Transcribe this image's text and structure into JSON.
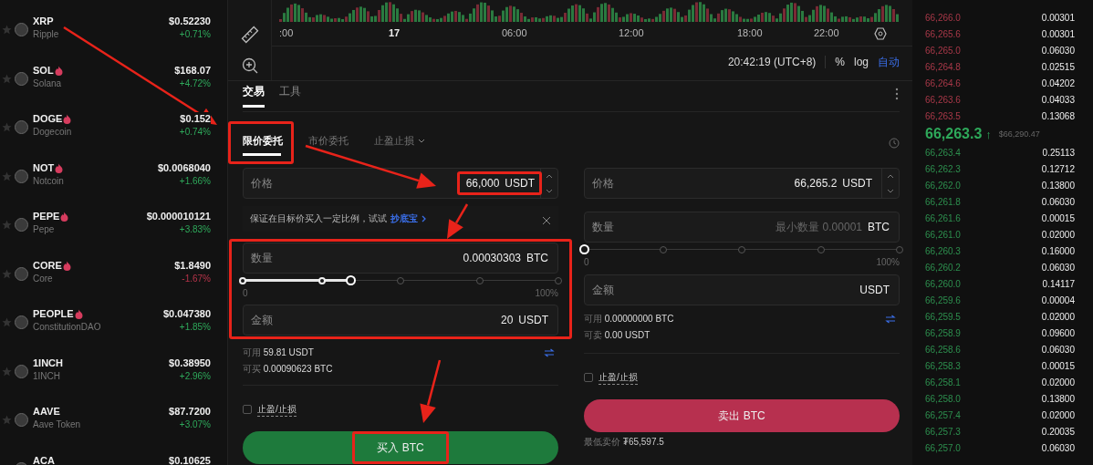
{
  "coins": [
    {
      "symbol": "XRP",
      "name": "Ripple",
      "price": "$0.52230",
      "change": "+0.71%",
      "kind": "gain",
      "hot": false
    },
    {
      "symbol": "SOL",
      "name": "Solana",
      "price": "$168.07",
      "change": "+4.72%",
      "kind": "gain",
      "hot": true
    },
    {
      "symbol": "DOGE",
      "name": "Dogecoin",
      "price": "$0.152",
      "change": "+0.74%",
      "kind": "gain",
      "hot": true
    },
    {
      "symbol": "NOT",
      "name": "Notcoin",
      "price": "$0.0068040",
      "change": "+1.66%",
      "kind": "gain",
      "hot": true
    },
    {
      "symbol": "PEPE",
      "name": "Pepe",
      "price": "$0.000010121",
      "change": "+3.83%",
      "kind": "gain",
      "hot": true
    },
    {
      "symbol": "CORE",
      "name": "Core",
      "price": "$1.8490",
      "change": "-1.67%",
      "kind": "loss",
      "hot": true
    },
    {
      "symbol": "PEOPLE",
      "name": "ConstitutionDAO",
      "price": "$0.047380",
      "change": "+1.85%",
      "kind": "gain",
      "hot": true
    },
    {
      "symbol": "1INCH",
      "name": "1INCH",
      "price": "$0.38950",
      "change": "+2.96%",
      "kind": "gain",
      "hot": false
    },
    {
      "symbol": "AAVE",
      "name": "Aave Token",
      "price": "$87.7200",
      "change": "+3.07%",
      "kind": "gain",
      "hot": false
    },
    {
      "symbol": "ACA",
      "price": "$0.10625",
      "hot": false
    }
  ],
  "chart": {
    "time_labels": [
      ":00",
      "17",
      "06:00",
      "12:00",
      "18:00",
      "22:00"
    ],
    "clock": "20:42:19 (UTC+8)",
    "scale_buttons": [
      {
        "label": "%",
        "selected": false
      },
      {
        "label": "log",
        "selected": false
      },
      {
        "label": "自动",
        "selected": true
      }
    ]
  },
  "trade": {
    "tabs": [
      {
        "label": "交易",
        "selected": true
      },
      {
        "label": "工具",
        "selected": false
      }
    ],
    "order_types": [
      {
        "label": "限价委托",
        "selected": true,
        "highlighted": true,
        "dropdown": false
      },
      {
        "label": "市价委托",
        "selected": false,
        "highlighted": false,
        "dropdown": false
      },
      {
        "label": "止盈止损",
        "selected": false,
        "highlighted": false,
        "dropdown": true
      }
    ],
    "buy": {
      "price": {
        "label": "价格",
        "value": "66,000",
        "unit": "USDT",
        "highlighted": true
      },
      "tip": {
        "text": "保证在目标价买入一定比例，试试",
        "link": "抄底宝"
      },
      "group_highlighted": true,
      "quantity": {
        "label": "数量",
        "value": "0.00030303",
        "unit": "BTC"
      },
      "slider": {
        "level": 0.34,
        "min_label": "0",
        "max_label": "100%"
      },
      "amount": {
        "label": "金额",
        "value": "20",
        "unit": "USDT"
      },
      "balances": [
        {
          "label": "可用",
          "value": "59.81 USDT"
        },
        {
          "label": "可买",
          "value": "0.00090623 BTC"
        }
      ],
      "tp_sl": {
        "label": "止盈/止损",
        "checked": false
      },
      "button": {
        "label": "买入 BTC",
        "highlighted": true
      }
    },
    "sell": {
      "price": {
        "label": "价格",
        "value": "66,265.2",
        "unit": "USDT",
        "highlighted": false
      },
      "quantity": {
        "label": "数量",
        "placeholder": "最小数量 0.00001",
        "unit": "BTC"
      },
      "slider": {
        "level": 0,
        "min_label": "0",
        "max_label": "100%"
      },
      "amount": {
        "label": "金额",
        "unit": "USDT"
      },
      "balances": [
        {
          "label": "可用",
          "value": "0.00000000 BTC"
        },
        {
          "label": "可卖",
          "value": "0.00 USDT"
        }
      ],
      "tp_sl": {
        "label": "止盈/止损",
        "checked": false
      },
      "button": {
        "label": "卖出 BTC",
        "highlighted": false
      },
      "note_label": "最低卖价",
      "note_value": "₮65,597.5"
    }
  },
  "order_book": {
    "asks": [
      {
        "price": "66,266.0",
        "amount": "0.00301"
      },
      {
        "price": "66,265.6",
        "amount": "0.00301"
      },
      {
        "price": "66,265.0",
        "amount": "0.06030"
      },
      {
        "price": "66,264.8",
        "amount": "0.02515"
      },
      {
        "price": "66,264.6",
        "amount": "0.04202"
      },
      {
        "price": "66,263.6",
        "amount": "0.04033"
      },
      {
        "price": "66,263.5",
        "amount": "0.13068"
      }
    ],
    "last_price": "66,263.3",
    "last_arrow": "↑",
    "index_price": "$66,290.47",
    "bids": [
      {
        "price": "66,263.4",
        "amount": "0.25113"
      },
      {
        "price": "66,262.3",
        "amount": "0.12712"
      },
      {
        "price": "66,262.0",
        "amount": "0.13800"
      },
      {
        "price": "66,261.8",
        "amount": "0.06030"
      },
      {
        "price": "66,261.6",
        "amount": "0.00015"
      },
      {
        "price": "66,261.0",
        "amount": "0.02000"
      },
      {
        "price": "66,260.3",
        "amount": "0.16000"
      },
      {
        "price": "66,260.2",
        "amount": "0.06030"
      },
      {
        "price": "66,260.0",
        "amount": "0.14117"
      },
      {
        "price": "66,259.6",
        "amount": "0.00004"
      },
      {
        "price": "66,259.5",
        "amount": "0.02000"
      },
      {
        "price": "66,258.9",
        "amount": "0.09600"
      },
      {
        "price": "66,258.6",
        "amount": "0.06030"
      },
      {
        "price": "66,258.3",
        "amount": "0.00015"
      },
      {
        "price": "66,258.1",
        "amount": "0.02000"
      },
      {
        "price": "66,258.0",
        "amount": "0.13800"
      },
      {
        "price": "66,257.4",
        "amount": "0.02000"
      },
      {
        "price": "66,257.3",
        "amount": "0.20035"
      },
      {
        "price": "66,257.0",
        "amount": "0.06030"
      }
    ]
  }
}
